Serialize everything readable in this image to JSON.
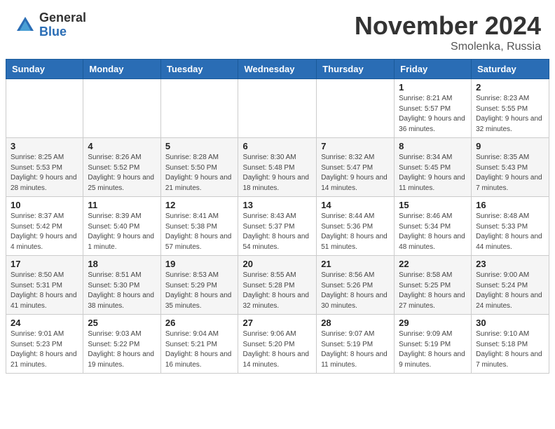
{
  "header": {
    "logo_general": "General",
    "logo_blue": "Blue",
    "month_title": "November 2024",
    "location": "Smolenka, Russia"
  },
  "days_of_week": [
    "Sunday",
    "Monday",
    "Tuesday",
    "Wednesday",
    "Thursday",
    "Friday",
    "Saturday"
  ],
  "weeks": [
    [
      {
        "day": "",
        "info": ""
      },
      {
        "day": "",
        "info": ""
      },
      {
        "day": "",
        "info": ""
      },
      {
        "day": "",
        "info": ""
      },
      {
        "day": "",
        "info": ""
      },
      {
        "day": "1",
        "info": "Sunrise: 8:21 AM\nSunset: 5:57 PM\nDaylight: 9 hours and 36 minutes."
      },
      {
        "day": "2",
        "info": "Sunrise: 8:23 AM\nSunset: 5:55 PM\nDaylight: 9 hours and 32 minutes."
      }
    ],
    [
      {
        "day": "3",
        "info": "Sunrise: 8:25 AM\nSunset: 5:53 PM\nDaylight: 9 hours and 28 minutes."
      },
      {
        "day": "4",
        "info": "Sunrise: 8:26 AM\nSunset: 5:52 PM\nDaylight: 9 hours and 25 minutes."
      },
      {
        "day": "5",
        "info": "Sunrise: 8:28 AM\nSunset: 5:50 PM\nDaylight: 9 hours and 21 minutes."
      },
      {
        "day": "6",
        "info": "Sunrise: 8:30 AM\nSunset: 5:48 PM\nDaylight: 9 hours and 18 minutes."
      },
      {
        "day": "7",
        "info": "Sunrise: 8:32 AM\nSunset: 5:47 PM\nDaylight: 9 hours and 14 minutes."
      },
      {
        "day": "8",
        "info": "Sunrise: 8:34 AM\nSunset: 5:45 PM\nDaylight: 9 hours and 11 minutes."
      },
      {
        "day": "9",
        "info": "Sunrise: 8:35 AM\nSunset: 5:43 PM\nDaylight: 9 hours and 7 minutes."
      }
    ],
    [
      {
        "day": "10",
        "info": "Sunrise: 8:37 AM\nSunset: 5:42 PM\nDaylight: 9 hours and 4 minutes."
      },
      {
        "day": "11",
        "info": "Sunrise: 8:39 AM\nSunset: 5:40 PM\nDaylight: 9 hours and 1 minute."
      },
      {
        "day": "12",
        "info": "Sunrise: 8:41 AM\nSunset: 5:38 PM\nDaylight: 8 hours and 57 minutes."
      },
      {
        "day": "13",
        "info": "Sunrise: 8:43 AM\nSunset: 5:37 PM\nDaylight: 8 hours and 54 minutes."
      },
      {
        "day": "14",
        "info": "Sunrise: 8:44 AM\nSunset: 5:36 PM\nDaylight: 8 hours and 51 minutes."
      },
      {
        "day": "15",
        "info": "Sunrise: 8:46 AM\nSunset: 5:34 PM\nDaylight: 8 hours and 48 minutes."
      },
      {
        "day": "16",
        "info": "Sunrise: 8:48 AM\nSunset: 5:33 PM\nDaylight: 8 hours and 44 minutes."
      }
    ],
    [
      {
        "day": "17",
        "info": "Sunrise: 8:50 AM\nSunset: 5:31 PM\nDaylight: 8 hours and 41 minutes."
      },
      {
        "day": "18",
        "info": "Sunrise: 8:51 AM\nSunset: 5:30 PM\nDaylight: 8 hours and 38 minutes."
      },
      {
        "day": "19",
        "info": "Sunrise: 8:53 AM\nSunset: 5:29 PM\nDaylight: 8 hours and 35 minutes."
      },
      {
        "day": "20",
        "info": "Sunrise: 8:55 AM\nSunset: 5:28 PM\nDaylight: 8 hours and 32 minutes."
      },
      {
        "day": "21",
        "info": "Sunrise: 8:56 AM\nSunset: 5:26 PM\nDaylight: 8 hours and 30 minutes."
      },
      {
        "day": "22",
        "info": "Sunrise: 8:58 AM\nSunset: 5:25 PM\nDaylight: 8 hours and 27 minutes."
      },
      {
        "day": "23",
        "info": "Sunrise: 9:00 AM\nSunset: 5:24 PM\nDaylight: 8 hours and 24 minutes."
      }
    ],
    [
      {
        "day": "24",
        "info": "Sunrise: 9:01 AM\nSunset: 5:23 PM\nDaylight: 8 hours and 21 minutes."
      },
      {
        "day": "25",
        "info": "Sunrise: 9:03 AM\nSunset: 5:22 PM\nDaylight: 8 hours and 19 minutes."
      },
      {
        "day": "26",
        "info": "Sunrise: 9:04 AM\nSunset: 5:21 PM\nDaylight: 8 hours and 16 minutes."
      },
      {
        "day": "27",
        "info": "Sunrise: 9:06 AM\nSunset: 5:20 PM\nDaylight: 8 hours and 14 minutes."
      },
      {
        "day": "28",
        "info": "Sunrise: 9:07 AM\nSunset: 5:19 PM\nDaylight: 8 hours and 11 minutes."
      },
      {
        "day": "29",
        "info": "Sunrise: 9:09 AM\nSunset: 5:19 PM\nDaylight: 8 hours and 9 minutes."
      },
      {
        "day": "30",
        "info": "Sunrise: 9:10 AM\nSunset: 5:18 PM\nDaylight: 8 hours and 7 minutes."
      }
    ]
  ]
}
